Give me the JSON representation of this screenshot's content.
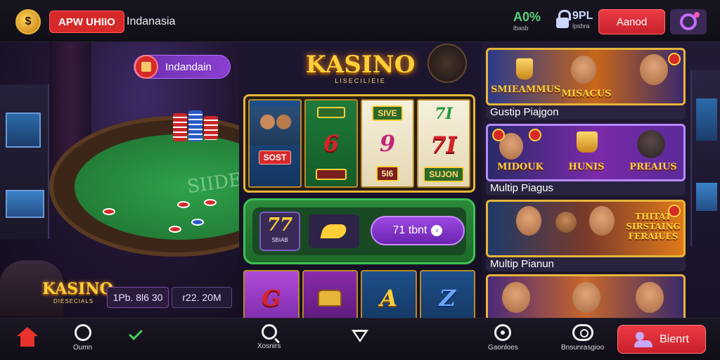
{
  "header": {
    "logo_glyph": "$",
    "brand": "APW UHIIO",
    "region": "Indanasia",
    "stat_one": {
      "value": "A0%",
      "label": "lbasb"
    },
    "stat_two": {
      "value": "9PL",
      "label": "lpsbra"
    },
    "login_label": "Aanod"
  },
  "scene": {
    "region_pill": "Indandain",
    "felt_text": "SIIDE",
    "logo_text": "KASINO",
    "logo_sub": "DIESECIALS",
    "jackpot_one": "1Pb. 8l6 30",
    "jackpot_two": "r22. 20M"
  },
  "slot": {
    "title": "KASINO",
    "subtitle": "LISECILIEIE",
    "reel_badge": "SOST",
    "reel_symbols": {
      "r1_bottom": "",
      "r2_mid": "6",
      "r3_top": "SIVE",
      "r3_mid": "9",
      "r3_bottom": "5I6",
      "r4_top": "7I",
      "r4_mid": "7I",
      "r4_bottom": "SUJON"
    },
    "bet": {
      "value": "77",
      "label": "SBIAB"
    },
    "spin_label": "71 tbnt",
    "bottom_reels": [
      "G",
      "",
      "A",
      "Z"
    ]
  },
  "cards": [
    {
      "banner": "SMIEAMMUS",
      "banner2": "MISACUS",
      "caption": "Gustip Piajgon"
    },
    {
      "banner": "MIDOUK",
      "banner2": "HUNIS",
      "banner3": "PREAIUS",
      "caption": "Multip Piagus"
    },
    {
      "banner": "THITAT SIRSTAING FERAIUES",
      "caption": "Multip Pianun"
    },
    {
      "banner": "",
      "caption": ""
    }
  ],
  "bottomnav": {
    "item1": "Oumn",
    "item3": "Xosnirs",
    "item5": "Gaonloes",
    "item6": "Bnsunrasgioo",
    "deposit": "Bienrt"
  },
  "colors": {
    "accent_red": "#d62a2a",
    "accent_purple": "#8c3fd0",
    "accent_gold": "#e6b53a",
    "accent_green": "#3fbf57"
  }
}
